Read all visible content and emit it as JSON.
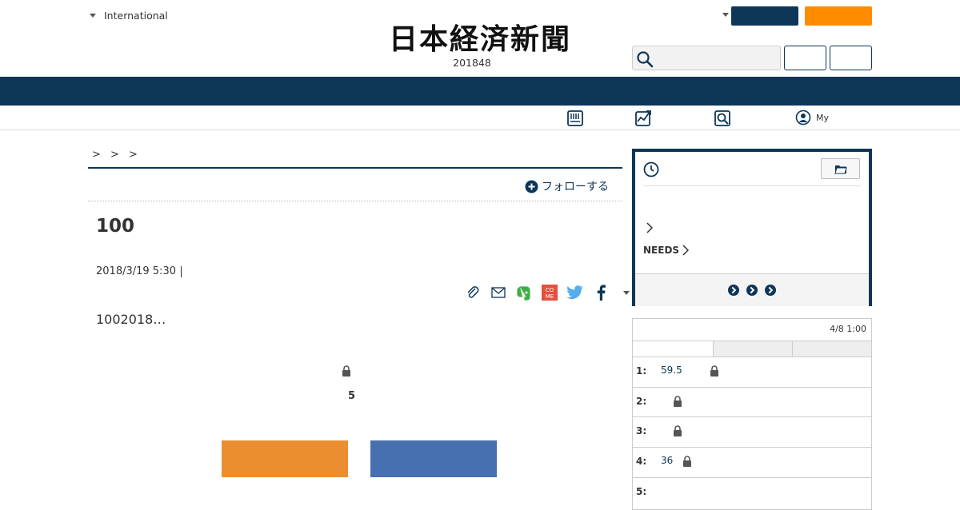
{
  "header": {
    "edition_link": "International",
    "logo_alt": "日本経済新聞",
    "edition_number": "201848",
    "brand_navy": "#0d3658",
    "brand_orange": "#ff8c00"
  },
  "subnav": {
    "my_label": "My"
  },
  "article": {
    "breadcrumb": "> > >",
    "follow_label": "フォローする",
    "title": "100",
    "date": "2018/3/19 5:30",
    "lead": "1002018…",
    "remaining_count": "5",
    "cta_colors": [
      "#ea8e30",
      "#4670b0"
    ]
  },
  "sidebar": {
    "history_box": {
      "needs_label": "NEEDS"
    },
    "ranking": {
      "updated": "4/8 1:00",
      "rows": [
        {
          "rank": "1:",
          "text": "59.5",
          "locked": true
        },
        {
          "rank": "2:",
          "text": "",
          "locked": true
        },
        {
          "rank": "3:",
          "text": "",
          "locked": true
        },
        {
          "rank": "4:",
          "text": "36",
          "locked": true
        },
        {
          "rank": "5:",
          "text": "",
          "locked": false
        }
      ]
    }
  }
}
